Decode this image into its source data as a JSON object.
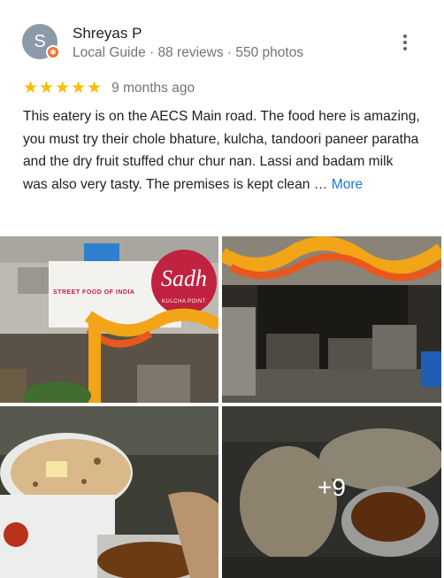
{
  "review": {
    "avatar_letter": "S",
    "author_name": "Shreyas P",
    "author_meta": "Local Guide · 88 reviews · 550 photos",
    "rating": 5,
    "stars_text": "★★★★★",
    "time_ago": "9 months ago",
    "text": "This eatery is on the AECS Main road. The food here is amazing, you must try their chole bhature, kulcha, tandoori paneer paratha and the dry fruit stuffed chur chur nan. Lassi and badam milk was also very tasty. The premises is kept clean …",
    "more_label": "More"
  },
  "photos": {
    "storefront_sign_left": "STREET FOOD OF INDIA",
    "storefront_logo": "Sadh",
    "storefront_logo_sub": "KULCHA POINT",
    "extra_count": "+9"
  },
  "colors": {
    "star": "#fbbc04",
    "link": "#1a73e8",
    "guide_badge": "#f4702c",
    "avatar": "#8a9aa8"
  },
  "icons": {
    "menu": "more-vert-icon",
    "badge": "local-guide-icon"
  }
}
